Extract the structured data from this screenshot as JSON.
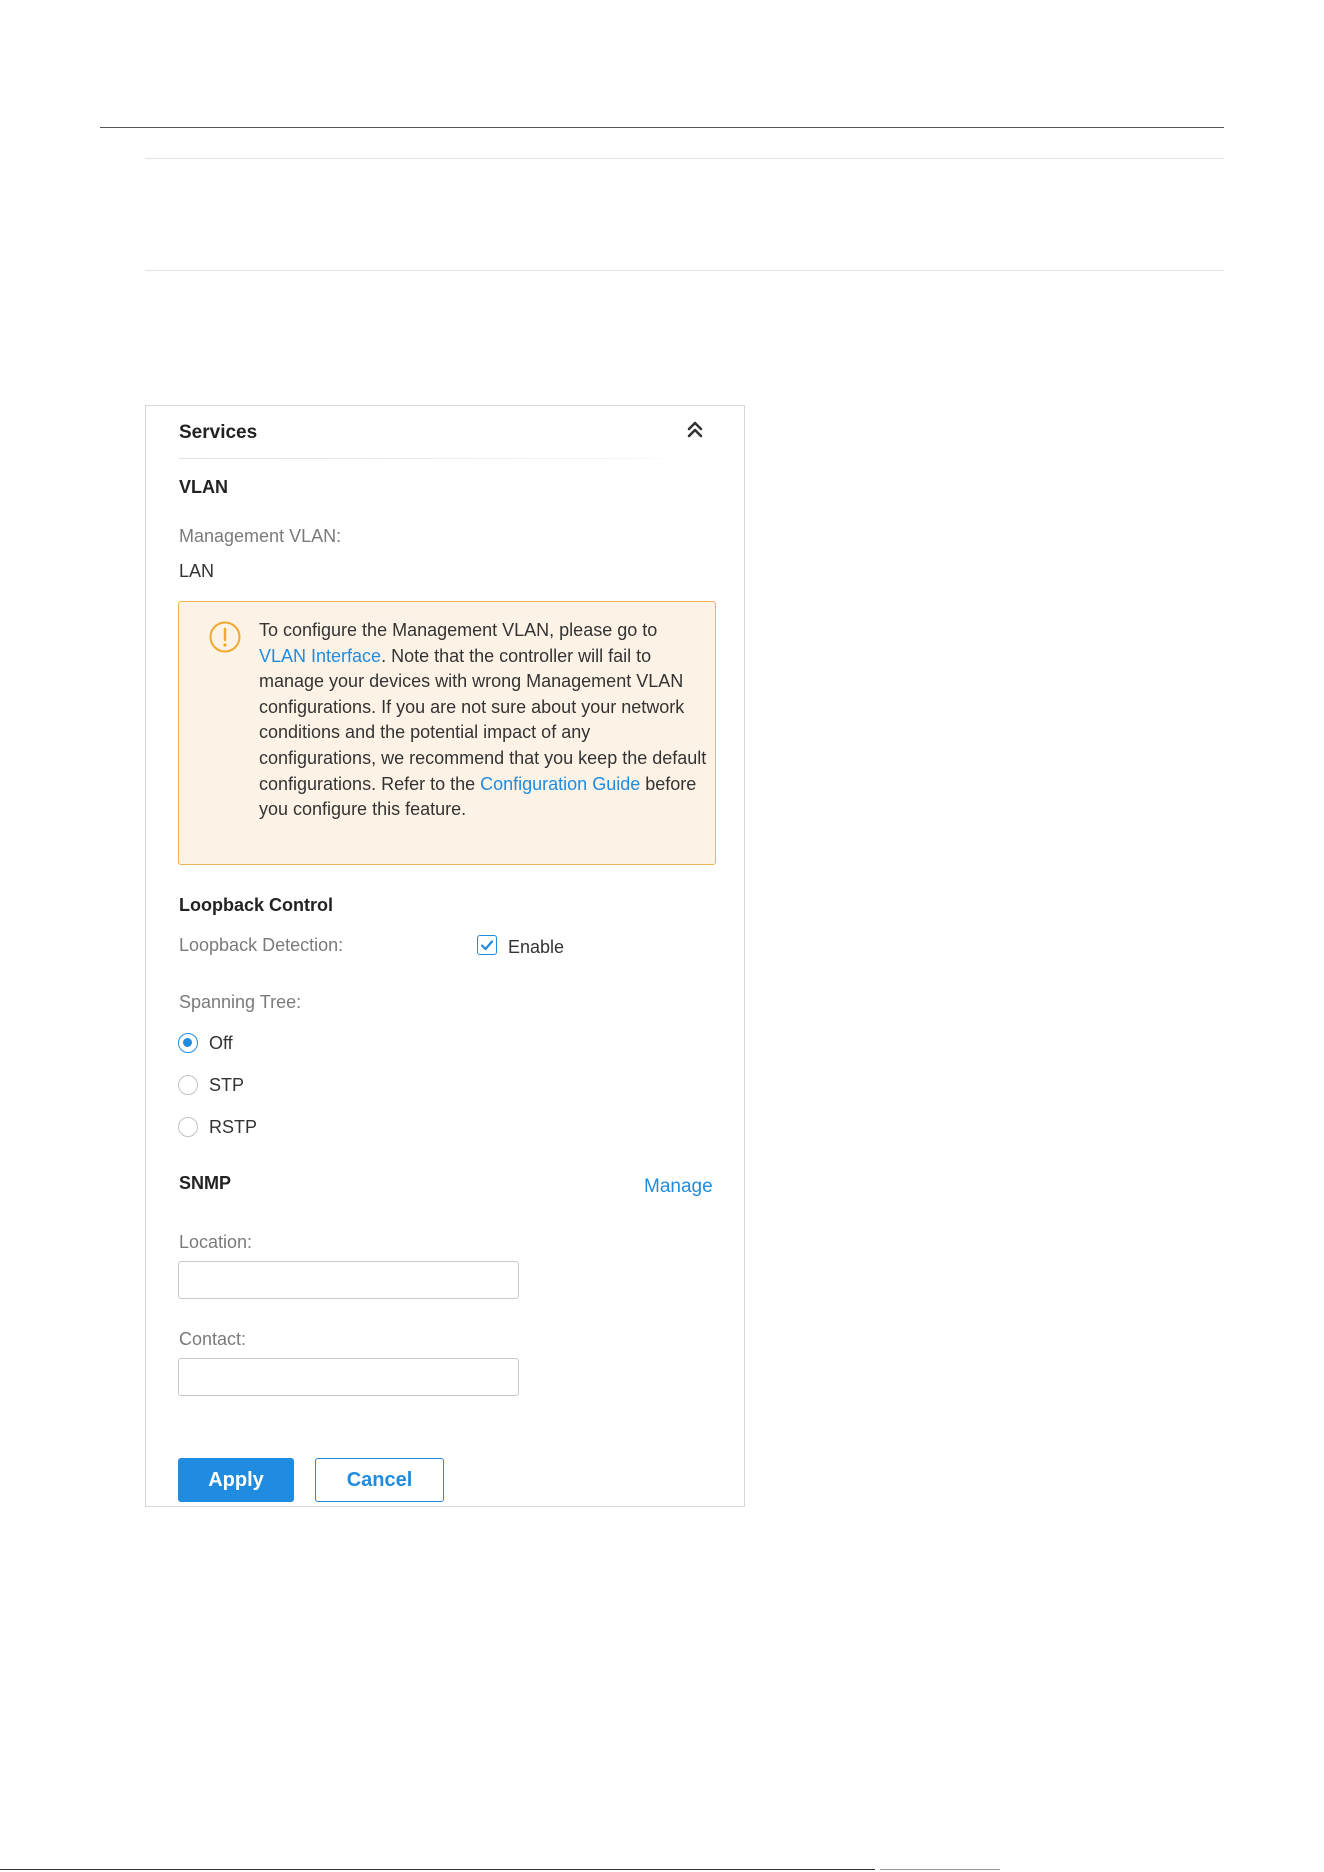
{
  "panel": {
    "title": "Services",
    "collapse_icon": "double-chevron-up-icon"
  },
  "vlan": {
    "heading": "VLAN",
    "management_label": "Management VLAN:",
    "management_value": "LAN",
    "notice": {
      "icon": "warning-circle-icon",
      "text_1": "To configure the Management VLAN, please go to ",
      "link_1": "VLAN Interface",
      "text_2": ". Note that the controller will fail to manage your devices with wrong Management VLAN configurations. If you are not sure about your network conditions and the potential impact of any configurations, we recommend that you keep the default configurations. Refer to the ",
      "link_2": "Configuration Guide",
      "text_3": " before you configure this feature."
    }
  },
  "loopback": {
    "heading": "Loopback Control",
    "detection_label": "Loopback Detection:",
    "enable_label": "Enable",
    "enable_checked": true,
    "spanning_tree_label": "Spanning Tree:",
    "spanning_tree_options": [
      "Off",
      "STP",
      "RSTP"
    ],
    "spanning_tree_selected": "Off"
  },
  "snmp": {
    "heading": "SNMP",
    "manage_label": "Manage",
    "location_label": "Location:",
    "location_value": "",
    "contact_label": "Contact:",
    "contact_value": ""
  },
  "actions": {
    "apply_label": "Apply",
    "cancel_label": "Cancel"
  },
  "colors": {
    "accent": "#1f8ce0",
    "warning_border": "#f0b35a",
    "warning_bg": "#fdf2e6"
  }
}
